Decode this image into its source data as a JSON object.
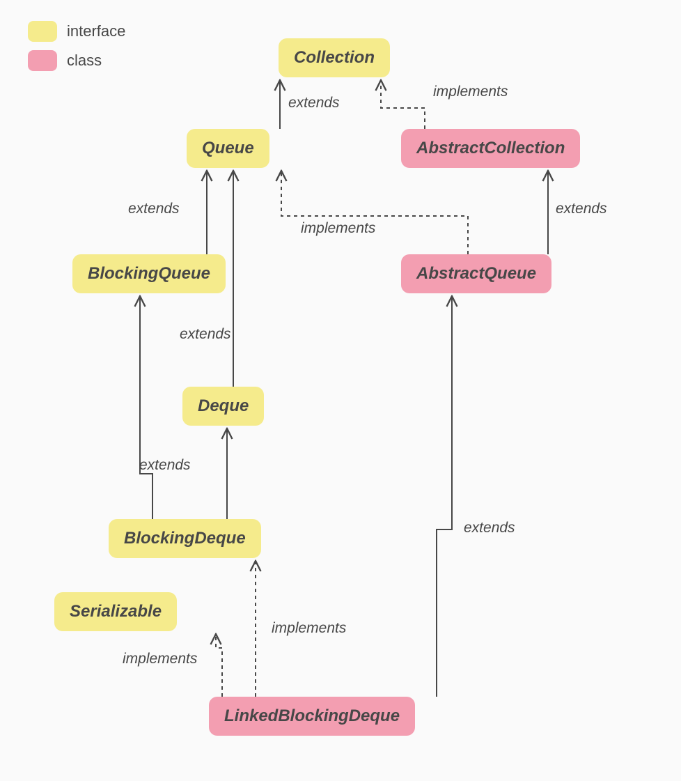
{
  "legend": {
    "interface_label": "interface",
    "class_label": "class"
  },
  "colors": {
    "interface": "#F5EB8C",
    "class": "#F39EB1",
    "edge": "#474747",
    "text": "#474747"
  },
  "nodes": {
    "collection": {
      "label": "Collection",
      "type": "interface"
    },
    "queue": {
      "label": "Queue",
      "type": "interface"
    },
    "abstract_collection": {
      "label": "AbstractCollection",
      "type": "class"
    },
    "blocking_queue": {
      "label": "BlockingQueue",
      "type": "interface"
    },
    "abstract_queue": {
      "label": "AbstractQueue",
      "type": "class"
    },
    "deque": {
      "label": "Deque",
      "type": "interface"
    },
    "blocking_deque": {
      "label": "BlockingDeque",
      "type": "interface"
    },
    "serializable": {
      "label": "Serializable",
      "type": "interface"
    },
    "linked_blocking_deque": {
      "label": "LinkedBlockingDeque",
      "type": "class"
    }
  },
  "edges": [
    {
      "from": "queue",
      "to": "collection",
      "style": "solid",
      "label": "extends"
    },
    {
      "from": "abstract_collection",
      "to": "collection",
      "style": "dashed",
      "label": "implements"
    },
    {
      "from": "blocking_queue",
      "to": "queue",
      "style": "solid",
      "label": "extends"
    },
    {
      "from": "deque",
      "to": "queue",
      "style": "solid",
      "label": "extends"
    },
    {
      "from": "abstract_queue",
      "to": "abstract_collection",
      "style": "solid",
      "label": "extends"
    },
    {
      "from": "abstract_queue",
      "to": "queue",
      "style": "dashed",
      "label": "implements"
    },
    {
      "from": "blocking_deque",
      "to": "blocking_queue",
      "style": "solid",
      "label": "extends"
    },
    {
      "from": "blocking_deque",
      "to": "deque",
      "style": "solid",
      "label": "extends"
    },
    {
      "from": "linked_blocking_deque",
      "to": "blocking_deque",
      "style": "dashed",
      "label": "implements"
    },
    {
      "from": "linked_blocking_deque",
      "to": "serializable",
      "style": "dashed",
      "label": "implements"
    },
    {
      "from": "linked_blocking_deque",
      "to": "abstract_queue",
      "style": "solid",
      "label": "extends"
    }
  ],
  "edge_labels": {
    "queue_ext_collection": "extends",
    "abscol_impl_collection": "implements",
    "blockq_ext_queue": "extends",
    "deque_ext_queue": "extends",
    "absq_ext_abscol": "extends",
    "absq_impl_queue": "implements",
    "blockd_ext_blockq_deque": "extends",
    "lbd_impl_blockd": "implements",
    "lbd_impl_serial": "implements",
    "lbd_ext_absq": "extends"
  }
}
